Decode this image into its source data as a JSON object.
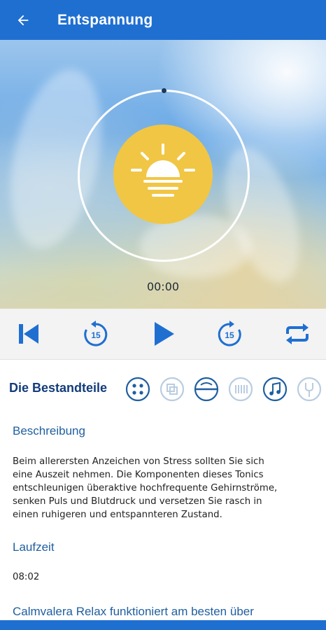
{
  "appbar": {
    "title": "Entspannung",
    "back_icon": "arrow-left-icon"
  },
  "player": {
    "time": "00:00",
    "artwork_icon": "sunrise-icon",
    "controls": [
      {
        "name": "skip-previous-button",
        "icon": "skip-previous-icon"
      },
      {
        "name": "rewind-15-button",
        "icon": "replay-15-icon",
        "value": "15"
      },
      {
        "name": "play-button",
        "icon": "play-icon"
      },
      {
        "name": "forward-15-button",
        "icon": "forward-15-icon",
        "value": "15"
      },
      {
        "name": "repeat-button",
        "icon": "repeat-icon"
      }
    ]
  },
  "components": {
    "title": "Die Bestandteile",
    "icons": [
      "dots-icon",
      "layers-icon",
      "wave-circle-icon",
      "bars-icon",
      "music-note-icon",
      "fork-icon"
    ]
  },
  "description": {
    "heading": "Beschreibung",
    "text": "Beim allerersten Anzeichen von Stress sollten Sie sich\neine Auszeit nehmen. Die Komponenten dieses Tonics\nentschleunigen überaktive hochfrequente Gehirnströme,\nsenken Puls und Blutdruck und versetzen Sie rasch in\neinen ruhigeren und entspannteren Zustand."
  },
  "runtime": {
    "heading": "Laufzeit",
    "value": "08:02"
  },
  "best_with": {
    "heading": "Calmvalera Relax funktioniert am besten über"
  },
  "colors": {
    "primary": "#1f6fd1",
    "accent_dark": "#123c7a",
    "sun": "#f1c644"
  }
}
